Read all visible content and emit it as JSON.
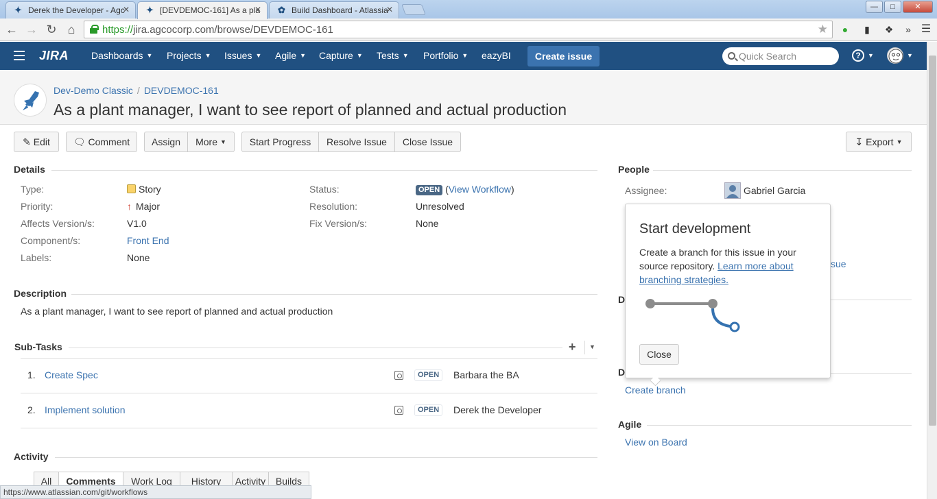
{
  "browser": {
    "tabs": [
      {
        "title": "Derek the Developer - Agc"
      },
      {
        "title": "[DEVDEMOC-161] As a pla"
      },
      {
        "title": "Build Dashboard - Atlassia"
      }
    ],
    "url_scheme": "https://",
    "url_rest": "jira.agcocorp.com/browse/DEVDEMOC-161",
    "status_url": "https://www.atlassian.com/git/workflows"
  },
  "header": {
    "logo": "JIRA",
    "nav": [
      {
        "label": "Dashboards"
      },
      {
        "label": "Projects"
      },
      {
        "label": "Issues"
      },
      {
        "label": "Agile"
      },
      {
        "label": "Capture"
      },
      {
        "label": "Tests"
      },
      {
        "label": "Portfolio"
      },
      {
        "label": "eazyBI"
      }
    ],
    "create_label": "Create issue",
    "search_placeholder": "Quick Search",
    "help_label": "?"
  },
  "issue": {
    "project": "Dev-Demo Classic",
    "key": "DEVDEMOC-161",
    "summary": "As a plant manager, I want to see report of planned and actual production"
  },
  "actions": {
    "edit": "Edit",
    "comment": "Comment",
    "assign": "Assign",
    "more": "More",
    "start_progress": "Start Progress",
    "resolve": "Resolve Issue",
    "close": "Close Issue",
    "export": "Export"
  },
  "details": {
    "heading": "Details",
    "type_label": "Type:",
    "type_value": "Story",
    "priority_label": "Priority:",
    "priority_value": "Major",
    "affects_label": "Affects Version/s:",
    "affects_value": "V1.0",
    "component_label": "Component/s:",
    "component_value": "Front End",
    "labels_label": "Labels:",
    "labels_value": "None",
    "status_label": "Status:",
    "status_value": "OPEN",
    "view_workflow": "View Workflow",
    "resolution_label": "Resolution:",
    "resolution_value": "Unresolved",
    "fix_label": "Fix Version/s:",
    "fix_value": "None"
  },
  "description": {
    "heading": "Description",
    "text": "As a plant manager, I want to see report of planned and actual production"
  },
  "subtasks": {
    "heading": "Sub-Tasks",
    "items": [
      {
        "num": "1.",
        "summary": "Create Spec",
        "status": "OPEN",
        "assignee": "Barbara the BA"
      },
      {
        "num": "2.",
        "summary": "Implement solution",
        "status": "OPEN",
        "assignee": "Derek the Developer"
      }
    ]
  },
  "activity": {
    "heading": "Activity",
    "tabs": [
      "All",
      "Comments",
      "Work Log",
      "History",
      "Activity",
      "Builds"
    ]
  },
  "people": {
    "heading": "People",
    "assignee_label": "Assignee:",
    "assignee_value": "Gabriel Garcia",
    "hidden_partial": "sue"
  },
  "sidebar": {
    "d1": "D",
    "d2": "D",
    "create_branch": "Create branch",
    "agile_heading": "Agile",
    "view_on_board": "View on Board"
  },
  "popup": {
    "title": "Start development",
    "text_before": "Create a branch for this issue in your source repository. ",
    "link": "Learn more about branching strategies.",
    "close_label": "Close"
  },
  "colors": {
    "header_bg": "#205081",
    "link": "#3b73af",
    "lozenge": "#4a6785",
    "branch_accent": "#3572b0"
  }
}
